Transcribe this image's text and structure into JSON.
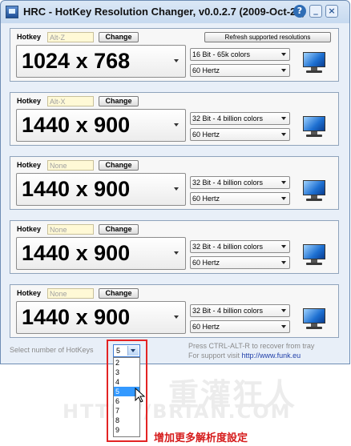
{
  "window": {
    "title": "HRC - HotKey Resolution Changer, v0.0.2.7 (2009-Oct-25)"
  },
  "titlebar_buttons": {
    "help": "?",
    "minimize": "_",
    "close": "×"
  },
  "labels": {
    "hotkey": "Hotkey",
    "change": "Change",
    "refresh": "Refresh supported resolutions"
  },
  "panels": [
    {
      "hotkey": "Alt-Z",
      "resolution": "1024 x 768",
      "depth": "16 Bit - 65k colors",
      "freq": "60 Hertz"
    },
    {
      "hotkey": "Alt-X",
      "resolution": "1440 x 900",
      "depth": "32 Bit - 4 billion colors",
      "freq": "60 Hertz"
    },
    {
      "hotkey": "None",
      "resolution": "1440 x 900",
      "depth": "32 Bit - 4 billion colors",
      "freq": "60 Hertz"
    },
    {
      "hotkey": "None",
      "resolution": "1440 x 900",
      "depth": "32 Bit - 4 billion colors",
      "freq": "60 Hertz"
    },
    {
      "hotkey": "None",
      "resolution": "1440 x 900",
      "depth": "32 Bit - 4 billion colors",
      "freq": "60 Hertz"
    }
  ],
  "footer": {
    "select_label": "Select number of HotKeys",
    "selected": "5",
    "options": [
      "2",
      "3",
      "4",
      "5",
      "6",
      "7",
      "8",
      "9"
    ],
    "press_text": "Press CTRL-ALT-R to recover from tray",
    "support_text": "For support visit",
    "support_link": "http://www.funk.eu"
  },
  "annotation": "增加更多解析度設定",
  "watermark": {
    "line1": "重灌狂人",
    "line2": "HTTP://BRIAN.COM"
  },
  "colors": {
    "highlight": "#e32424",
    "hotkey_field": "#fff9d6",
    "selected_option": "#3399ff"
  }
}
